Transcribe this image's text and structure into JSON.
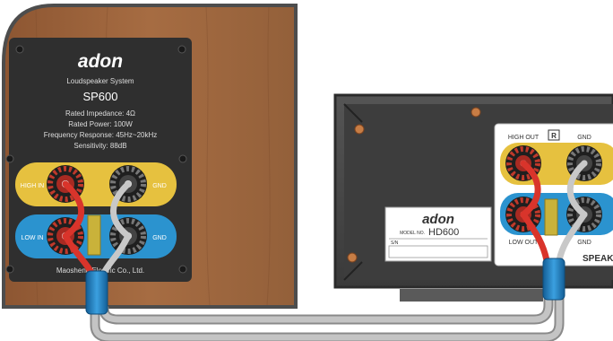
{
  "speaker": {
    "brand": "adon",
    "subtitle": "Loudspeaker System",
    "model": "SP600",
    "specs": [
      "Rated Impedance: 4Ω",
      "Rated Power: 100W",
      "Frequency Response: 45Hz~20kHz",
      "Sensitivity: 88dB"
    ],
    "terminals": {
      "high_in": "HIGH IN",
      "high_gnd": "GND",
      "low_in": "LOW IN",
      "low_gnd": "GND"
    },
    "maker": "Maosheng Electric Co., Ltd.",
    "colors": {
      "wood": "#a0673f",
      "plate": "#2f2f2f",
      "high_band": "#e6c13f",
      "low_band": "#2b93cf"
    }
  },
  "amplifier": {
    "terminals": {
      "high_out": "HIGH OUT",
      "channel": "R",
      "high_gnd": "GND",
      "low_out": "LOW OUT",
      "low_gnd": "GND",
      "section_label": "SPEAKER"
    },
    "label": {
      "brand": "adon",
      "model_prefix": "MODEL NO.",
      "model": "HD600",
      "serial_prefix": "S/N"
    },
    "colors": {
      "chassis": "#3e3e3e",
      "panel": "#2a2a2a",
      "copper": "#c77d45"
    }
  },
  "cable": {
    "colors": {
      "jacket": "#b9b9b9",
      "plug": "#1f7fc2",
      "wire_red": "#d9342b",
      "heatshrink": "#c9b23a"
    }
  }
}
